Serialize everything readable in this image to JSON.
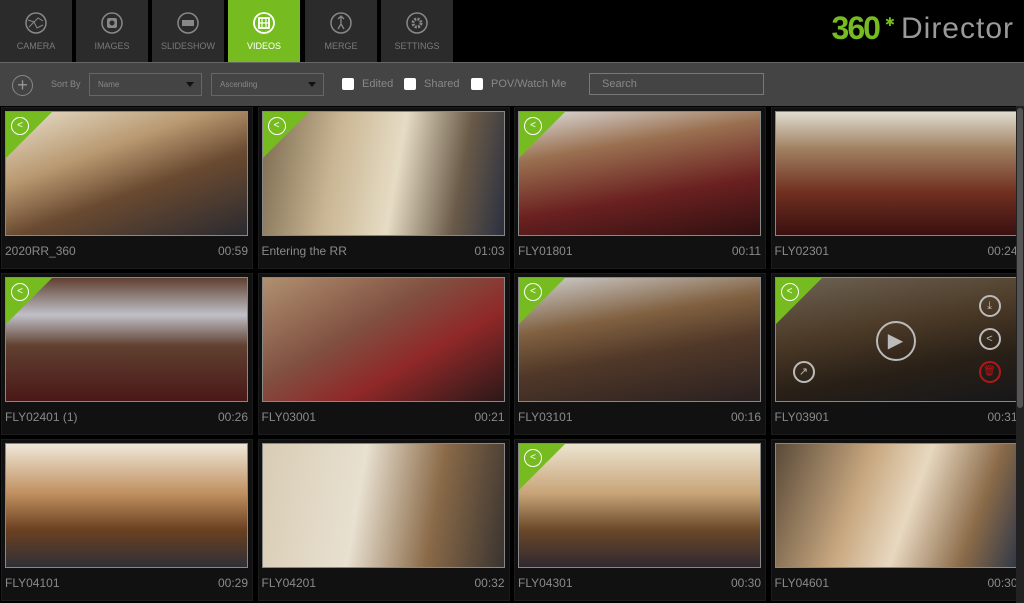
{
  "nav": {
    "tabs": [
      {
        "label": "CAMERA",
        "icon": "camera-globe-icon"
      },
      {
        "label": "IMAGES",
        "icon": "images-icon"
      },
      {
        "label": "SLIDESHOW",
        "icon": "slideshow-icon"
      },
      {
        "label": "VIDEOS",
        "icon": "film-icon",
        "active": true
      },
      {
        "label": "MERGE",
        "icon": "merge-icon"
      },
      {
        "label": "SETTINGS",
        "icon": "gear-icon"
      }
    ]
  },
  "logo": {
    "number": "360",
    "text": "Director"
  },
  "toolbar": {
    "sort_by": "Sort By",
    "sort_field": "Name",
    "sort_order": "Ascending",
    "filters": [
      "Edited",
      "Shared",
      "POV/Watch Me"
    ],
    "search_placeholder": "Search"
  },
  "accent": "#76bc21",
  "videos": [
    {
      "name": "2020RR_360",
      "duration": "00:59",
      "shared": true
    },
    {
      "name": "Entering the RR",
      "duration": "01:03",
      "shared": true
    },
    {
      "name": "FLY01801",
      "duration": "00:11",
      "shared": true
    },
    {
      "name": "FLY02301",
      "duration": "00:24",
      "shared": false
    },
    {
      "name": "FLY02401 (1)",
      "duration": "00:26",
      "shared": true
    },
    {
      "name": "FLY03001",
      "duration": "00:21",
      "shared": false
    },
    {
      "name": "FLY03101",
      "duration": "00:16",
      "shared": true
    },
    {
      "name": "FLY03901",
      "duration": "00:31",
      "shared": true,
      "hovered": true
    },
    {
      "name": "FLY04101",
      "duration": "00:29",
      "shared": false
    },
    {
      "name": "FLY04201",
      "duration": "00:32",
      "shared": false
    },
    {
      "name": "FLY04301",
      "duration": "00:30",
      "shared": true
    },
    {
      "name": "FLY04601",
      "duration": "00:30",
      "shared": false
    }
  ]
}
